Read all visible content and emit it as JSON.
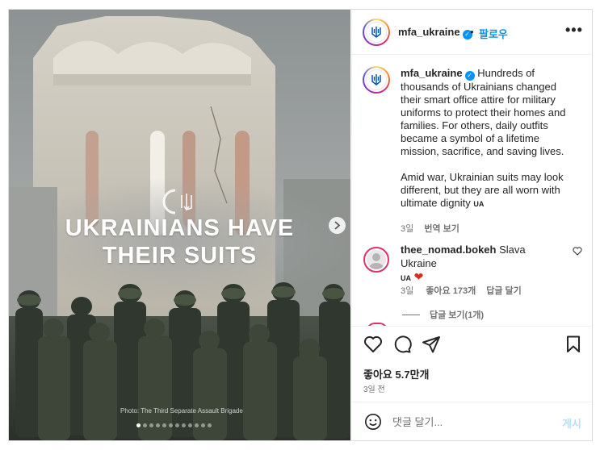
{
  "post": {
    "headline_line1": "UKRAINIANS HAVE",
    "headline_line2": "THEIR SUITS",
    "photo_credit": "Photo: The Third Separate Assault Brigade",
    "carousel_count": 12,
    "carousel_active": 1
  },
  "header": {
    "username": "mfa_ukraine",
    "dot": "•",
    "follow_label": "팔로우",
    "more_label": "•••"
  },
  "caption": {
    "username": "mfa_ukraine",
    "paragraph1": "Hundreds of thousands of Ukrainians changed their smart office attire for military uniforms to protect their homes and families. For others, daily outfits became a symbol of a lifetime mission, sacrifice, and saving lives.",
    "paragraph2": "Amid war, Ukrainian suits may look different, but they are all worn with ultimate dignity",
    "flag": "UA",
    "time": "3일",
    "translate": "번역 보기"
  },
  "comment": {
    "username": "thee_nomad.bokeh",
    "text": "Slava Ukraine",
    "flag": "UA",
    "emoji": "❤",
    "time": "3일",
    "likes": "좋아요 173개",
    "reply": "답글 달기",
    "view_replies": "답글 보기(1개)"
  },
  "actions": {
    "likes": "좋아요 5.7만개",
    "posted_ago": "3일 전"
  },
  "composer": {
    "placeholder": "댓글 달기...",
    "post_label": "게시"
  },
  "icons": {
    "verified": "verified-badge-icon",
    "like": "heart-icon",
    "comment": "comment-bubble-icon",
    "share": "paper-plane-icon",
    "save": "bookmark-icon",
    "emoji": "smiley-icon",
    "next": "chevron-right-icon",
    "trident": "trident-icon"
  },
  "colors": {
    "accent": "#0095f6",
    "heart_red": "#e0281b"
  }
}
